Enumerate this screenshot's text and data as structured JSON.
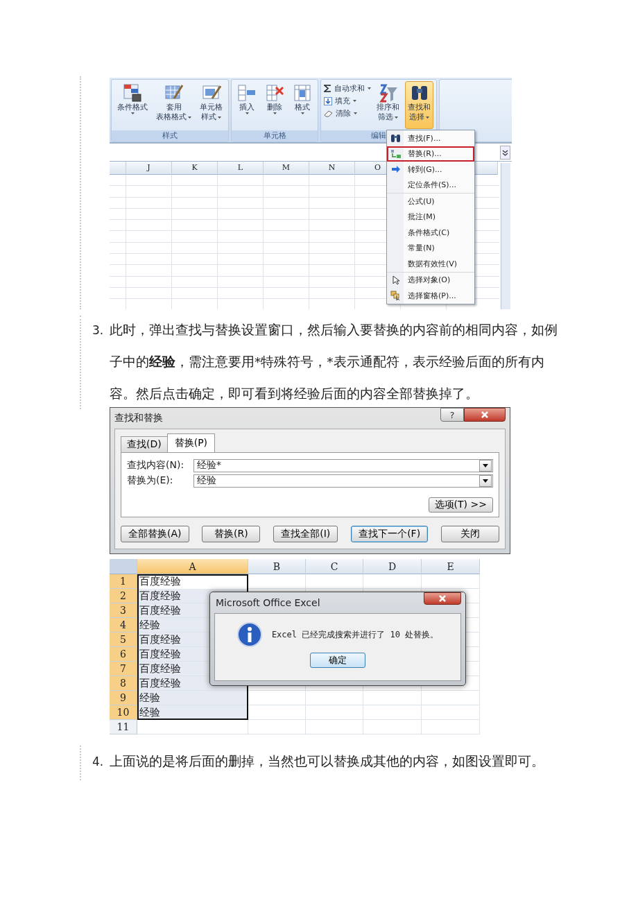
{
  "ribbon_screenshot": {
    "groups": [
      {
        "label": "样式",
        "buttons": [
          {
            "kind": "conditional-format",
            "lines": [
              "条件格式"
            ],
            "dropdown": true,
            "selected": false
          },
          {
            "kind": "table-style",
            "lines": [
              "套用",
              "表格格式"
            ],
            "dropdown": true,
            "selected": false
          },
          {
            "kind": "cell-style",
            "lines": [
              "单元格",
              "样式"
            ],
            "dropdown": true,
            "selected": false
          }
        ]
      },
      {
        "label": "单元格",
        "buttons": [
          {
            "kind": "insert",
            "lines": [
              "插入"
            ],
            "dropdown": true,
            "selected": false
          },
          {
            "kind": "delete",
            "lines": [
              "删除"
            ],
            "dropdown": true,
            "selected": false
          },
          {
            "kind": "format",
            "lines": [
              "格式"
            ],
            "dropdown": true,
            "selected": false
          }
        ]
      },
      {
        "label": "编辑",
        "small_buttons": [
          {
            "kind": "autosum",
            "label": "自动求和",
            "dropdown": true
          },
          {
            "kind": "fill",
            "label": "填充",
            "dropdown": true
          },
          {
            "kind": "clear",
            "label": "清除",
            "dropdown": true
          }
        ],
        "buttons": [
          {
            "kind": "sort-filter",
            "lines": [
              "排序和",
              "筛选"
            ],
            "dropdown": true,
            "selected": false
          },
          {
            "kind": "find-select",
            "lines": [
              "查找和",
              "选择"
            ],
            "dropdown": true,
            "selected": true
          }
        ]
      }
    ],
    "columns": [
      "J",
      "K",
      "L",
      "M",
      "N",
      "O"
    ],
    "menu": {
      "groups": [
        [
          {
            "kind": "find",
            "label": "查找(F)...",
            "selected": false
          },
          {
            "kind": "replace",
            "label": "替换(R)...",
            "selected": true
          },
          {
            "kind": "goto",
            "label": "转到(G)...",
            "selected": false
          },
          {
            "kind": "plain",
            "label": "定位条件(S)...",
            "selected": false
          }
        ],
        [
          {
            "kind": "plain",
            "label": "公式(U)",
            "selected": false
          },
          {
            "kind": "plain",
            "label": "批注(M)",
            "selected": false
          },
          {
            "kind": "plain",
            "label": "条件格式(C)",
            "selected": false
          },
          {
            "kind": "plain",
            "label": "常量(N)",
            "selected": false
          },
          {
            "kind": "plain",
            "label": "数据有效性(V)",
            "selected": false
          }
        ],
        [
          {
            "kind": "select-objects",
            "label": "选择对象(O)",
            "selected": false
          },
          {
            "kind": "selection-pane",
            "label": "选择窗格(P)...",
            "selected": false
          }
        ]
      ]
    }
  },
  "step_3": {
    "number": "3.",
    "text": [
      {
        "text": "此时，弹出查找与替换设置窗口，然后输入要替换的内容前的相同内容，如例子中的",
        "bold": false
      },
      {
        "text": "经验",
        "bold": true
      },
      {
        "text": "，需注意要用*特殊符号，*表示通配符，表示经验后面的所有内容。然后点击确定，即可看到将经验后面的内容全部替换掉了。",
        "bold": false
      }
    ]
  },
  "find_replace_dialog": {
    "title": "查找和替换",
    "help_button": "?",
    "tabs": [
      {
        "label": "查找(D)",
        "selected": false
      },
      {
        "label": "替换(P)",
        "selected": true
      }
    ],
    "fields": [
      {
        "label": "查找内容(N):",
        "value": "经验*"
      },
      {
        "label": "替换为(E):",
        "value": "经验"
      }
    ],
    "options_button": "选项(T) >>",
    "buttons": [
      {
        "label": "全部替换(A)",
        "default": false
      },
      {
        "label": "替换(R)",
        "default": false
      },
      {
        "label": "查找全部(I)",
        "default": false
      },
      {
        "label": "查找下一个(F)",
        "default": true
      },
      {
        "label": "关闭",
        "default": false
      }
    ]
  },
  "result_sheet": {
    "columns": [
      {
        "label": "A",
        "selected": true
      },
      {
        "label": "B",
        "selected": false
      },
      {
        "label": "C",
        "selected": false
      },
      {
        "label": "D",
        "selected": false
      },
      {
        "label": "E",
        "selected": false
      }
    ],
    "rows": [
      {
        "header": "1",
        "value": "百度经验",
        "selected": true,
        "active": true
      },
      {
        "header": "2",
        "value": "百度经验",
        "selected": true,
        "active": false
      },
      {
        "header": "3",
        "value": "百度经验",
        "selected": true,
        "active": false
      },
      {
        "header": "4",
        "value": "经验",
        "selected": true,
        "active": false
      },
      {
        "header": "5",
        "value": "百度经验",
        "selected": true,
        "active": false
      },
      {
        "header": "6",
        "value": "百度经验",
        "selected": true,
        "active": false
      },
      {
        "header": "7",
        "value": "百度经验",
        "selected": true,
        "active": false
      },
      {
        "header": "8",
        "value": "百度经验",
        "selected": true,
        "active": false
      },
      {
        "header": "9",
        "value": "经验",
        "selected": true,
        "active": false
      },
      {
        "header": "10",
        "value": "经验",
        "selected": true,
        "active": false
      },
      {
        "header": "11",
        "selected": false,
        "active": false
      }
    ],
    "message_box": {
      "title": "Microsoft Office Excel",
      "message": "Excel 已经完成搜索并进行了 10 处替换。",
      "button": "确定"
    }
  },
  "step_4": {
    "number": "4.",
    "text": "上面说的是将后面的删掉，当然也可以替换成其他的内容，如图设置即可。"
  }
}
